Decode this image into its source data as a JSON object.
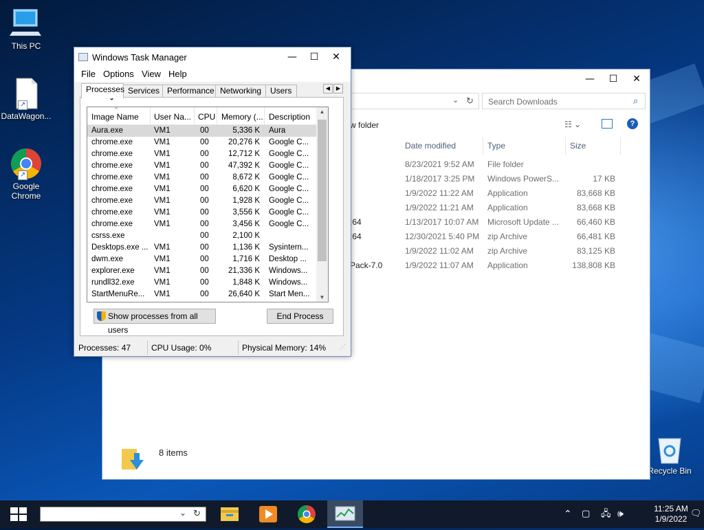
{
  "desktop": {
    "icons": [
      {
        "label": "This PC"
      },
      {
        "label": "DataWagon..."
      },
      {
        "label": "Google Chrome"
      },
      {
        "label": "Recycle Bin"
      }
    ]
  },
  "explorer": {
    "controls": {
      "minimize": "—",
      "maximize": "☐",
      "close": "✕"
    },
    "search_placeholder": "Search Downloads",
    "new_folder_fragment": "w folder",
    "columns": {
      "date": "Date modified",
      "type": "Type",
      "size": "Size"
    },
    "rows": [
      {
        "name": "",
        "date": "8/23/2021 9:52 AM",
        "type": "File folder",
        "size": ""
      },
      {
        "name": "",
        "date": "1/18/2017 3:25 PM",
        "type": "Windows PowerS...",
        "size": "17 KB"
      },
      {
        "name": "",
        "date": "1/9/2022 11:22 AM",
        "type": "Application",
        "size": "83,668 KB"
      },
      {
        "name": "",
        "date": "1/9/2022 11:21 AM",
        "type": "Application",
        "size": "83,668 KB"
      },
      {
        "name": ":64",
        "date": "1/13/2017 10:07 AM",
        "type": "Microsoft Update ...",
        "size": "66,460 KB"
      },
      {
        "name": ":64",
        "date": "12/30/2021 5:40 PM",
        "type": "zip Archive",
        "size": "66,481 KB"
      },
      {
        "name": "",
        "date": "1/9/2022 11:02 AM",
        "type": "zip Archive",
        "size": "83,125 KB"
      },
      {
        "name": "Pack-7.0",
        "date": "1/9/2022 11:07 AM",
        "type": "Application",
        "size": "138,808 KB"
      }
    ],
    "status": "8 items"
  },
  "taskmgr": {
    "title": "Windows Task Manager",
    "controls": {
      "minimize": "—",
      "maximize": "☐",
      "close": "✕"
    },
    "menu": [
      "File",
      "Options",
      "View",
      "Help"
    ],
    "tabs": [
      "Processes",
      "Services",
      "Performance",
      "Networking",
      "Users"
    ],
    "columns": [
      "Image Name",
      "User Na...",
      "CPU",
      "Memory (...",
      "Description"
    ],
    "processes": [
      {
        "name": "Aura.exe",
        "user": "VM1",
        "cpu": "00",
        "mem": "5,336 K",
        "desc": "Aura"
      },
      {
        "name": "chrome.exe",
        "user": "VM1",
        "cpu": "00",
        "mem": "20,276 K",
        "desc": "Google C..."
      },
      {
        "name": "chrome.exe",
        "user": "VM1",
        "cpu": "00",
        "mem": "12,712 K",
        "desc": "Google C..."
      },
      {
        "name": "chrome.exe",
        "user": "VM1",
        "cpu": "00",
        "mem": "47,392 K",
        "desc": "Google C..."
      },
      {
        "name": "chrome.exe",
        "user": "VM1",
        "cpu": "00",
        "mem": "8,672 K",
        "desc": "Google C..."
      },
      {
        "name": "chrome.exe",
        "user": "VM1",
        "cpu": "00",
        "mem": "6,620 K",
        "desc": "Google C..."
      },
      {
        "name": "chrome.exe",
        "user": "VM1",
        "cpu": "00",
        "mem": "1,928 K",
        "desc": "Google C..."
      },
      {
        "name": "chrome.exe",
        "user": "VM1",
        "cpu": "00",
        "mem": "3,556 K",
        "desc": "Google C..."
      },
      {
        "name": "chrome.exe",
        "user": "VM1",
        "cpu": "00",
        "mem": "3,456 K",
        "desc": "Google C..."
      },
      {
        "name": "csrss.exe",
        "user": "",
        "cpu": "00",
        "mem": "2,100 K",
        "desc": ""
      },
      {
        "name": "Desktops.exe ...",
        "user": "VM1",
        "cpu": "00",
        "mem": "1,136 K",
        "desc": "Sysintern..."
      },
      {
        "name": "dwm.exe",
        "user": "VM1",
        "cpu": "00",
        "mem": "1,716 K",
        "desc": "Desktop ..."
      },
      {
        "name": "explorer.exe",
        "user": "VM1",
        "cpu": "00",
        "mem": "21,336 K",
        "desc": "Windows..."
      },
      {
        "name": "rundll32.exe",
        "user": "VM1",
        "cpu": "00",
        "mem": "1,848 K",
        "desc": "Windows..."
      },
      {
        "name": "StartMenuRe...",
        "user": "VM1",
        "cpu": "00",
        "mem": "26,640 K",
        "desc": "Start Men..."
      }
    ],
    "show_all_label": "Show processes from all users",
    "end_process_label": "End Process",
    "status": {
      "processes": "Processes: 47",
      "cpu": "CPU Usage: 0%",
      "memory": "Physical Memory: 14%"
    }
  },
  "taskbar": {
    "clock_time": "11:25 AM",
    "clock_date": "1/9/2022",
    "icons": [
      "windows-start-icon",
      "file-explorer-icon",
      "media-player-icon",
      "chrome-icon",
      "task-manager-icon"
    ]
  },
  "colors": {
    "accent": "#0a57b8",
    "selection": "#d9d9d9",
    "taskbar": "#101a2a"
  }
}
